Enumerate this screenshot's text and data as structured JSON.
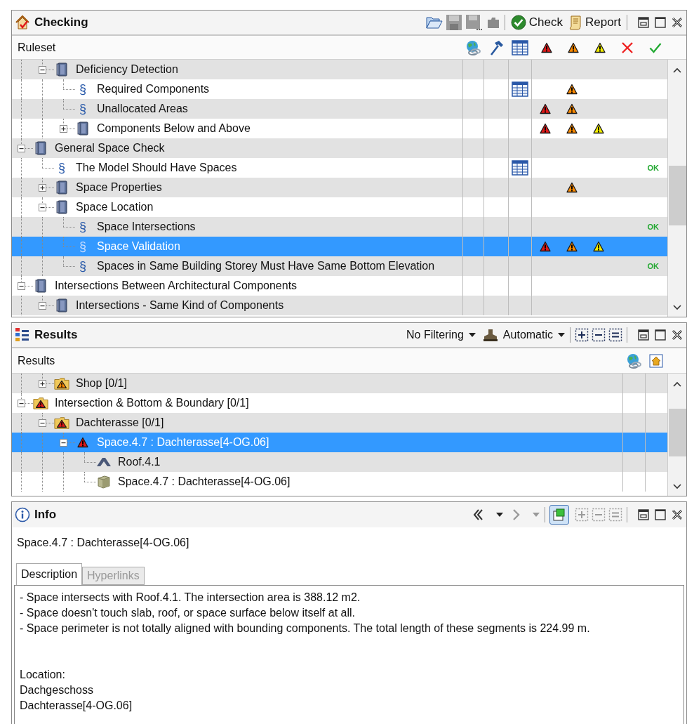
{
  "checking": {
    "title": "Checking",
    "check_button": "Check",
    "report_button": "Report",
    "header": "Ruleset",
    "rows": [
      {
        "kind": "ancestor",
        "children": [
          {
            "kind": "ruleset",
            "label": "Deficiency Detection",
            "expanded": true,
            "selected": false,
            "table": false,
            "error": false,
            "warning": false,
            "caution": false,
            "children": [
              {
                "kind": "rule",
                "symbol": "§",
                "label": "Required Components",
                "selected": false,
                "table": true,
                "error": false,
                "warning": true,
                "caution": false
              },
              {
                "kind": "rule",
                "symbol": "§",
                "label": "Unallocated Areas",
                "selected": false,
                "table": false,
                "error": true,
                "warning": true,
                "caution": false
              },
              {
                "kind": "ruleset",
                "label": "Components Below and Above",
                "expanded": false,
                "selected": false,
                "table": false,
                "error": true,
                "warning": true,
                "caution": true
              }
            ]
          }
        ]
      },
      {
        "kind": "ruleset",
        "label": "General Space Check",
        "expanded": true,
        "selected": false,
        "table": false,
        "error": false,
        "warning": false,
        "caution": false,
        "children": [
          {
            "kind": "rule",
            "symbol": "§",
            "label": "The Model Should Have Spaces",
            "selected": false,
            "table": true,
            "error": false,
            "warning": false,
            "caution": false,
            "ok": "OK"
          },
          {
            "kind": "ruleset",
            "label": "Space Properties",
            "expanded": false,
            "selected": false,
            "table": false,
            "error": false,
            "warning": true,
            "caution": false
          },
          {
            "kind": "ruleset",
            "label": "Space Location",
            "expanded": true,
            "selected": false,
            "table": false,
            "error": false,
            "warning": false,
            "caution": false,
            "children": [
              {
                "kind": "rule",
                "symbol": "§",
                "label": "Space Intersections",
                "selected": false,
                "table": false,
                "error": false,
                "warning": false,
                "caution": false,
                "ok": "OK"
              },
              {
                "kind": "rule",
                "symbol": "§",
                "label": "Space Validation",
                "selected": true,
                "table": false,
                "error": true,
                "warning": true,
                "caution": true
              },
              {
                "kind": "rule",
                "symbol": "§",
                "label": "Spaces in Same Building Storey Must Have Same Bottom Elevation",
                "selected": false,
                "table": false,
                "error": false,
                "warning": false,
                "caution": false,
                "ok": "OK"
              }
            ]
          }
        ]
      },
      {
        "kind": "ruleset",
        "label": "Intersections Between Architectural Components",
        "expanded": true,
        "selected": false,
        "table": false,
        "error": false,
        "warning": false,
        "caution": false,
        "children": [
          {
            "kind": "ruleset",
            "label": "Intersections - Same Kind of Components",
            "expanded": true,
            "selected": false,
            "table": false,
            "error": false,
            "warning": false,
            "caution": false
          }
        ]
      }
    ]
  },
  "results": {
    "title": "Results",
    "filter_dropdown": "No Filtering",
    "mode_dropdown": "Automatic",
    "header": "Results",
    "rows": [
      {
        "kind": "ancestor",
        "children": [
          {
            "kind": "warning-folder",
            "label": "Shop [0/1]",
            "expanded": false,
            "selected": false
          }
        ]
      },
      {
        "kind": "error-folder",
        "label": "Intersection & Bottom & Boundary [0/1]",
        "expanded": true,
        "selected": false,
        "children": [
          {
            "kind": "error-folder",
            "label": "Dachterasse [0/1]",
            "expanded": true,
            "selected": false,
            "children": [
              {
                "kind": "error",
                "label": "Space.4.7 : Dachterasse[4-OG.06]",
                "expanded": true,
                "selected": true,
                "children": [
                  {
                    "kind": "roof",
                    "label": "Roof.4.1",
                    "selected": false
                  },
                  {
                    "kind": "space",
                    "label": "Space.4.7 : Dachterasse[4-OG.06]",
                    "selected": false
                  }
                ]
              }
            ]
          }
        ]
      }
    ]
  },
  "info": {
    "title": "Info",
    "sync_selected": true,
    "subject": "Space.4.7 : Dachterasse[4-OG.06]",
    "tabs": [
      {
        "label": "Description",
        "selected": true
      },
      {
        "label": "Hyperlinks",
        "selected": false
      }
    ],
    "paragraphs": [
      [
        "- Space intersects with Roof.4.1. The intersection area is 388.12 m2.",
        "- Space doesn't touch slab, roof, or space surface below itself at all.",
        "- Space perimeter is not totally aligned with bounding components. The total length of these segments is 224.99 m."
      ],
      [
        "Location:",
        "Dachgeschoss",
        "Dachterasse[4-OG.06]"
      ]
    ]
  }
}
